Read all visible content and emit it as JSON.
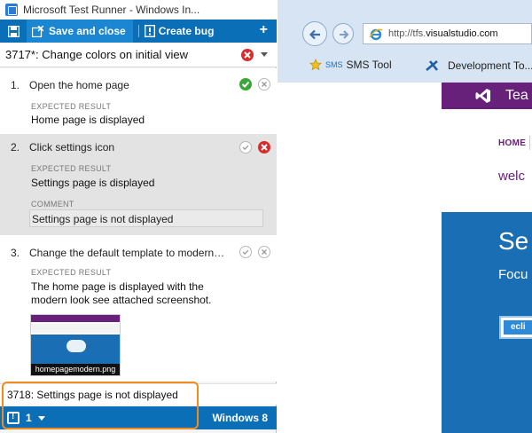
{
  "window": {
    "title": "Microsoft Test Runner - Windows In..."
  },
  "toolbar": {
    "save_label": "Save and close",
    "create_bug_label": "Create bug",
    "add_label": "+"
  },
  "test_case": {
    "title": "3717*: Change colors on initial view"
  },
  "steps": [
    {
      "number": "1.",
      "text": "Open the home page",
      "expected_label": "EXPECTED RESULT",
      "expected": "Home page is displayed",
      "status": "passed"
    },
    {
      "number": "2.",
      "text": "Click settings icon",
      "expected_label": "EXPECTED RESULT",
      "expected": "Settings page is displayed",
      "comment_label": "COMMENT",
      "comment": "Settings page is not displayed",
      "status": "failed"
    },
    {
      "number": "3.",
      "text": "Change the default template to modern a...",
      "expected_label": "EXPECTED RESULT",
      "expected_line1": "The home page is displayed with the",
      "expected_line2": "modern look see attached screenshot.",
      "attachment": "homepagemodern.png",
      "status": "none"
    }
  ],
  "bug": {
    "text": "3718: Settings page is not displayed"
  },
  "statusbar": {
    "bug_count": "1",
    "configuration": "Windows 8"
  },
  "browser": {
    "url_prefix": "http://tfs.",
    "url_host": "visualstudio.com",
    "favorites": [
      {
        "tag": "SMS",
        "label": "SMS Tool"
      },
      {
        "label": "Development To..."
      }
    ],
    "site": {
      "header_text": "Tea",
      "nav_home": "HOME",
      "welcome": "welc",
      "hero_title": "Se",
      "hero_subtitle": "Focu",
      "hero_button": "ecli"
    }
  },
  "colors": {
    "toolbar_blue": "#0b6fb8",
    "pass_green": "#3aa63a",
    "fail_red": "#d92b2b",
    "highlight_orange": "#f28c1e",
    "site_purple": "#68217a",
    "site_blue": "#1a6fb4"
  },
  "icons": [
    "save-disk-icon",
    "save-close-icon",
    "create-bug-icon",
    "add-icon",
    "fail-icon",
    "dropdown-icon",
    "pass-icon",
    "bug-icon",
    "back-arrow-icon",
    "forward-arrow-icon",
    "ie-icon",
    "favorite-star-icon",
    "vs-logo-icon"
  ]
}
